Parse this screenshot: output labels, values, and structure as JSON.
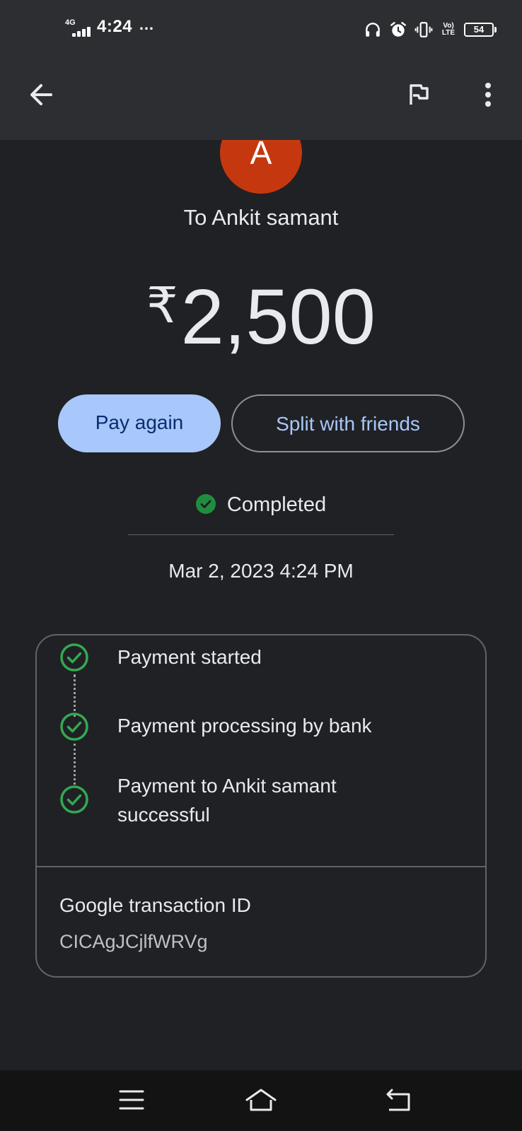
{
  "status_bar": {
    "network": "4G",
    "time": "4:24",
    "more": "…",
    "volte": "Vo) LTE",
    "battery": "54"
  },
  "header": {
    "back_icon": "arrow-back-icon",
    "flag_icon": "flag-icon",
    "more_icon": "more-vert-icon"
  },
  "payment": {
    "avatar_letter": "A",
    "avatar_color": "#c5380f",
    "payee": "To Ankit samant",
    "currency": "₹",
    "amount": "2,500"
  },
  "actions": {
    "pay_again": "Pay again",
    "split": "Split with friends"
  },
  "status": {
    "label": "Completed",
    "color": "#1e8e3e",
    "datetime": "Mar 2, 2023 4:24 PM"
  },
  "timeline": [
    {
      "text": "Payment started"
    },
    {
      "text": "Payment processing by bank"
    },
    {
      "text": "Payment to Ankit samant successful"
    }
  ],
  "transaction": {
    "label": "Google transaction ID",
    "id": "CICAgJCjlfWRVg"
  },
  "system_nav": {
    "menu_icon": "menu-icon",
    "home_icon": "home-icon",
    "back_icon": "return-icon"
  }
}
